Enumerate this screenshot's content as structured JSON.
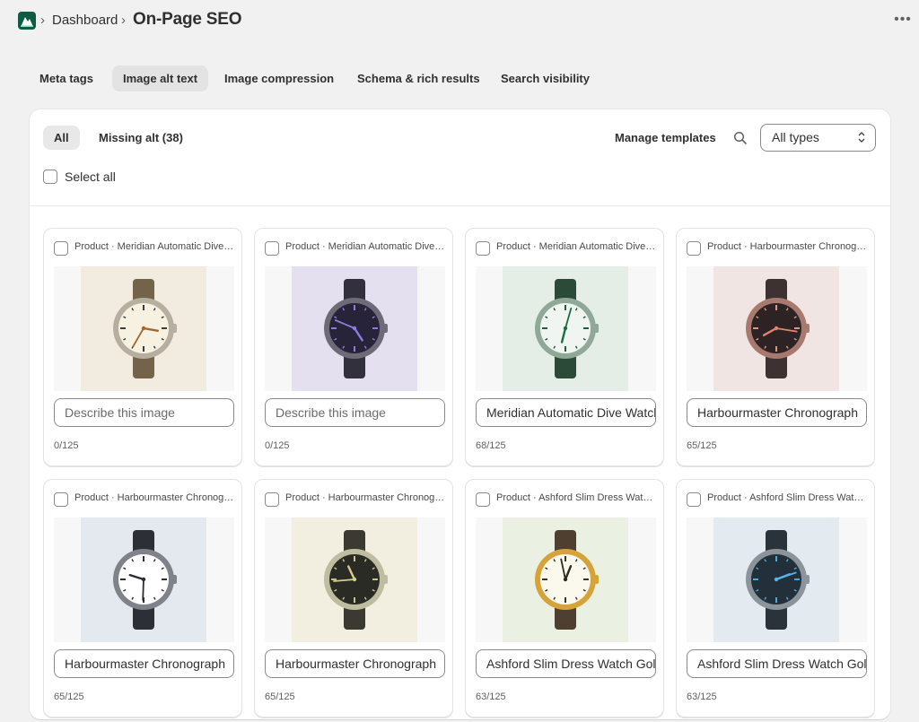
{
  "breadcrumb": {
    "parent": "Dashboard",
    "separator": "›",
    "title": "On-Page SEO"
  },
  "more_label": "•••",
  "tabs": [
    {
      "label": "Meta tags"
    },
    {
      "label": "Image alt text",
      "active": true
    },
    {
      "label": "Image compression"
    },
    {
      "label": "Schema & rich results"
    },
    {
      "label": "Search visibility"
    }
  ],
  "filters": {
    "all": "All",
    "missing": "Missing alt (38)"
  },
  "manage_templates": "Manage templates",
  "type_select": {
    "value": "All types"
  },
  "select_all": "Select all",
  "colors": {
    "accent": "#0f5c44",
    "surface": "#ffffff",
    "background": "#f1f1f1"
  },
  "images": [
    {
      "label": "Product · Meridian Automatic Dive Watch",
      "alt": "",
      "placeholder": "Describe this image",
      "count": "0/125",
      "colors": {
        "bg": "#f2ebe0",
        "strap": "#726349",
        "bezel": "#b6ae9f",
        "face": "#f7f1e2",
        "mark": "#3b3b3b",
        "hand": "#a5652d"
      }
    },
    {
      "label": "Product · Meridian Automatic Dive Watch",
      "alt": "",
      "placeholder": "Describe this image",
      "count": "0/125",
      "colors": {
        "bg": "#e5e0ef",
        "strap": "#33303d",
        "bezel": "#6e6a78",
        "face": "#27243a",
        "mark": "#8e7cd8",
        "hand": "#8f7ce0"
      }
    },
    {
      "label": "Product · Meridian Automatic Dive Watch",
      "alt": "Meridian Automatic Dive Watch",
      "placeholder": "Describe this image",
      "count": "68/125",
      "colors": {
        "bg": "#e4ede6",
        "strap": "#2c4a38",
        "bezel": "#8fa898",
        "face": "#f0f5f1",
        "mark": "#215a3c",
        "hand": "#1d6b43"
      }
    },
    {
      "label": "Product · Harbourmaster Chronograph",
      "alt": "Harbourmaster Chronograph",
      "placeholder": "Describe this image",
      "count": "65/125",
      "colors": {
        "bg": "#f0e5e3",
        "strap": "#3d3131",
        "bezel": "#a87a6f",
        "face": "#2d2325",
        "mark": "#d59b88",
        "hand": "#e2856b"
      }
    },
    {
      "label": "Product · Harbourmaster Chronograph",
      "alt": "Harbourmaster Chronograph",
      "placeholder": "Describe this image",
      "count": "65/125",
      "colors": {
        "bg": "#e4e8ef",
        "strap": "#2c2f36",
        "bezel": "#7f8289",
        "face": "#ffffff",
        "mark": "#2f2f2f",
        "hand": "#2a2d34"
      }
    },
    {
      "label": "Product · Harbourmaster Chronograph",
      "alt": "Harbourmaster Chronograph",
      "placeholder": "Describe this image",
      "count": "65/125",
      "colors": {
        "bg": "#f2efe0",
        "strap": "#3a3a33",
        "bezel": "#bfbda0",
        "face": "#2b2b26",
        "mark": "#c9c38d",
        "hand": "#d5cf8a"
      }
    },
    {
      "label": "Product · Ashford Slim Dress Watch Gold",
      "alt": "Ashford Slim Dress Watch Gold",
      "placeholder": "Describe this image",
      "count": "63/125",
      "colors": {
        "bg": "#eaf1e3",
        "strap": "#4e3f31",
        "bezel": "#d6a33b",
        "face": "#fbf8ee",
        "mark": "#3c3322",
        "hand": "#2d2820"
      }
    },
    {
      "label": "Product · Ashford Slim Dress Watch Gold",
      "alt": "Ashford Slim Dress Watch Gold",
      "placeholder": "Describe this image",
      "count": "63/125",
      "colors": {
        "bg": "#e3ebf0",
        "strap": "#2a3339",
        "bezel": "#8a949a",
        "face": "#23303a",
        "mark": "#4ea7db",
        "hand": "#55b3eb"
      }
    }
  ]
}
